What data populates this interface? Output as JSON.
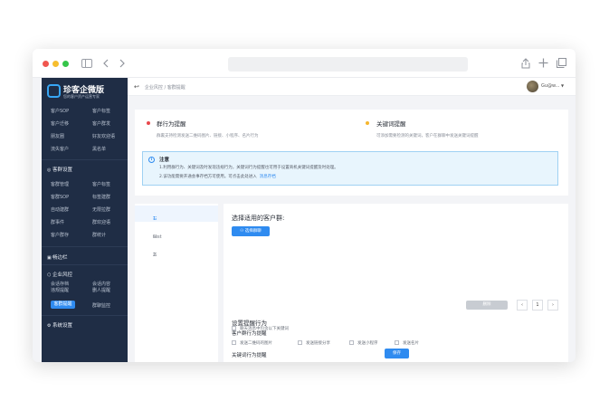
{
  "app": {
    "name": "珍客企微版",
    "tagline": "您的客户资产运营专家"
  },
  "colors": {
    "accent": "#2f8bf0",
    "sidebar_bg": "#1f2d45",
    "marker_red": "#e8474c",
    "marker_yellow": "#f6b62e"
  },
  "sidebar": {
    "top_rows": [
      [
        "客户SOP",
        "客户标签"
      ],
      [
        "客户迁移",
        "客户群发"
      ],
      [
        "朋友圈",
        "好友欢迎语"
      ],
      [
        "流失客户",
        "黑名单"
      ]
    ],
    "section_group": "客群设置",
    "group_rows": [
      [
        "客群管理",
        "客户标签"
      ],
      [
        "客群SOP",
        "标签建群"
      ],
      [
        "自动建群",
        "无限拉群"
      ],
      [
        "群事件",
        "群欢迎语"
      ],
      [
        "客户群存",
        "群统计"
      ]
    ],
    "section_tools": "畅边栏",
    "section_risk": "企业风控",
    "risk_rows": [
      [
        "会话存档",
        "会话内容"
      ],
      [
        "违规提醒",
        "删人提醒"
      ],
      [
        "客群提醒",
        "群聊监控"
      ]
    ],
    "section_system": "系统设置"
  },
  "topbar": {
    "breadcrumb": "企业风控 / 客群提醒",
    "user": "Gu@w..."
  },
  "panel_top": {
    "group_behavior": {
      "title": "群行为提醒",
      "desc": "群裏支持检测发送二维码图片、链接、小程序、名片行为"
    },
    "keyword": {
      "title": "关键词提醒",
      "desc": "可添加需要检测的关键词，客户在群聊中发送关键词提醒"
    },
    "notice": {
      "title": "注意",
      "line1": "1.利用群行为、关键词及时发现违规行为，关键词行为提醒也可用于设置商机关键词提醒及时处理。",
      "line2_text": "2.该功能需要开通会事存档方可使用。可点击此处进入",
      "line2_link": "消息存档"
    }
  },
  "rule_list": [
    "1",
    "test",
    "2"
  ],
  "detail": {
    "select_label": "选择适用的客户群:",
    "select_button": "选择群聊",
    "delete_button": "删除",
    "page": "1",
    "prev": "‹",
    "next": "›",
    "behavior_title": "设置提醒行为",
    "group_behavior_label": "客户群行为提醒",
    "options": [
      "发送二维码的图片",
      "发送链接分享",
      "发送小程序",
      "发送名片"
    ],
    "keyword_label": "关键词行为提醒",
    "keyword_option": "聊天消息中包含以下关键词",
    "save_button": "保存"
  }
}
